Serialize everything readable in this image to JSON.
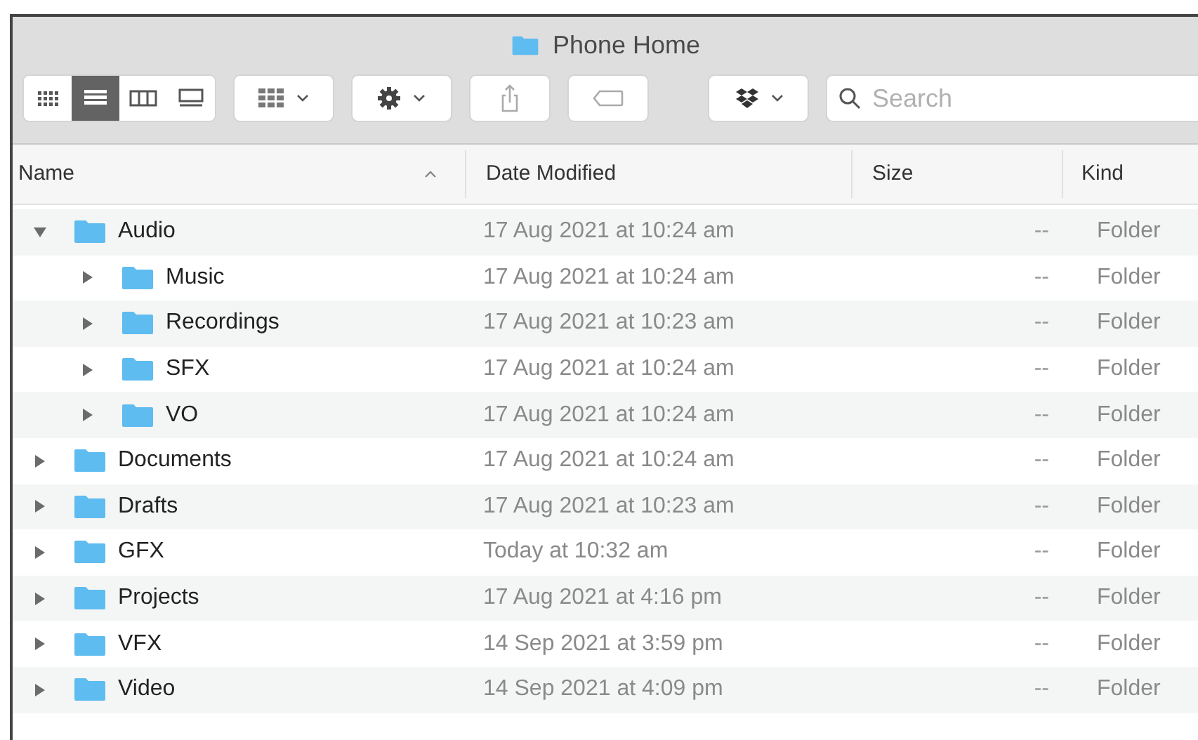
{
  "window": {
    "title": "Phone Home"
  },
  "toolbar": {
    "view_modes": [
      {
        "kind": "icons",
        "selected": false
      },
      {
        "kind": "list",
        "selected": true
      },
      {
        "kind": "columns",
        "selected": false
      },
      {
        "kind": "gallery",
        "selected": false
      }
    ],
    "search": {
      "placeholder": "Search"
    }
  },
  "table": {
    "columns": [
      {
        "label": "Name",
        "sorted": true
      },
      {
        "label": "Date Modified",
        "sorted": false
      },
      {
        "label": "Size",
        "sorted": false
      },
      {
        "label": "Kind",
        "sorted": false
      }
    ],
    "rows": [
      {
        "name": "Audio",
        "date": "17 Aug 2021 at 10:24 am",
        "size": "--",
        "kind": "Folder",
        "expanded": true,
        "children": [
          {
            "name": "Music",
            "date": "17 Aug 2021 at 10:24 am",
            "size": "--",
            "kind": "Folder",
            "expanded": false
          },
          {
            "name": "Recordings",
            "date": "17 Aug 2021 at 10:23 am",
            "size": "--",
            "kind": "Folder",
            "expanded": false
          },
          {
            "name": "SFX",
            "date": "17 Aug 2021 at 10:24 am",
            "size": "--",
            "kind": "Folder",
            "expanded": false
          },
          {
            "name": "VO",
            "date": "17 Aug 2021 at 10:24 am",
            "size": "--",
            "kind": "Folder",
            "expanded": false
          }
        ]
      },
      {
        "name": "Documents",
        "date": "17 Aug 2021 at 10:24 am",
        "size": "--",
        "kind": "Folder",
        "expanded": false
      },
      {
        "name": "Drafts",
        "date": "17 Aug 2021 at 10:23 am",
        "size": "--",
        "kind": "Folder",
        "expanded": false
      },
      {
        "name": "GFX",
        "date": "Today at 10:32 am",
        "size": "--",
        "kind": "Folder",
        "expanded": false
      },
      {
        "name": "Projects",
        "date": "17 Aug 2021 at 4:16 pm",
        "size": "--",
        "kind": "Folder",
        "expanded": false
      },
      {
        "name": "VFX",
        "date": "14 Sep 2021 at 3:59 pm",
        "size": "--",
        "kind": "Folder",
        "expanded": false
      },
      {
        "name": "Video",
        "date": "14 Sep 2021 at 4:09 pm",
        "size": "--",
        "kind": "Folder",
        "expanded": false
      }
    ]
  }
}
